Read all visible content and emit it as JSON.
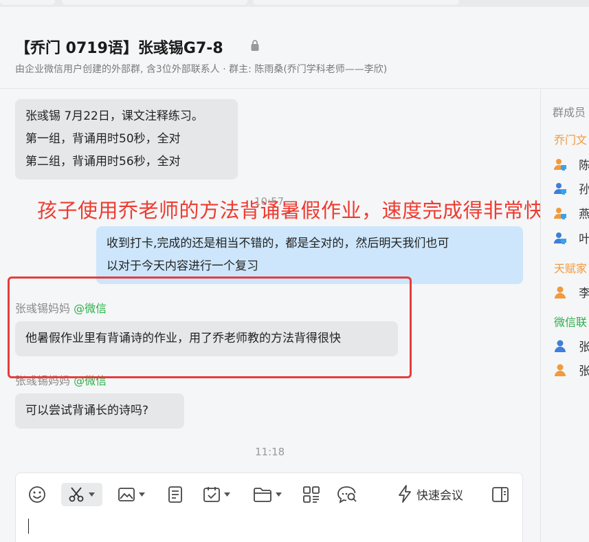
{
  "header": {
    "title": "【乔门 0719语】张彧锡G7-8",
    "subtitle": "由企业微信用户创建的外部群, 含3位外部联系人 · 群主: 陈雨桑(乔门学科老师——李欣)"
  },
  "messages": {
    "msg1": {
      "lines": [
        "张彧锡 7月22日，课文注释练习。",
        "第一组，背诵用时50秒，全对",
        "第二组，背诵用时56秒，全对"
      ]
    },
    "time1": "10:57",
    "msg2": {
      "lines": [
        "收到打卡,完成的还是相当不错的，都是全对的，然后明天我们也可",
        "以对于今天内容进行一个复习"
      ]
    },
    "msg3": {
      "sender": "张彧锡妈妈",
      "sender_suffix": "@微信",
      "text": "他暑假作业里有背诵诗的作业，用了乔老师教的方法背得很快"
    },
    "msg4": {
      "sender": "张彧锡妈妈",
      "sender_suffix": "@微信",
      "text": "可以尝试背诵长的诗吗?"
    },
    "time2": "11:18"
  },
  "overlay": {
    "annotation": "孩子使用乔老师的方法背诵暑假作业，速度完成得非常快"
  },
  "sidebar": {
    "title": "群成员",
    "groups": [
      {
        "label": "乔门文",
        "color": "#f29a3c",
        "members": [
          {
            "name": "陈",
            "icon": "user-enterprise-icon",
            "color": "#f29a3c"
          },
          {
            "name": "孙",
            "icon": "user-enterprise-icon",
            "color": "#3d7fd9"
          },
          {
            "name": "燕",
            "icon": "user-enterprise-icon",
            "color": "#f29a3c"
          },
          {
            "name": "叶",
            "icon": "user-enterprise-icon",
            "color": "#3d7fd9"
          }
        ]
      },
      {
        "label": "天赋家",
        "color": "#f29a3c",
        "members": [
          {
            "name": "李",
            "icon": "user-icon",
            "color": "#f29a3c"
          }
        ]
      },
      {
        "label": "微信联",
        "color": "#2bb04a",
        "members": [
          {
            "name": "张",
            "icon": "user-icon",
            "color": "#3d7fd9"
          },
          {
            "name": "张",
            "icon": "user-icon",
            "color": "#f29a3c"
          }
        ]
      }
    ]
  },
  "composer": {
    "toolbar": [
      "emoji-icon",
      "screenshot-scissors-icon",
      "image-icon",
      "document-icon",
      "schedule-icon",
      "folder-icon",
      "apps-grid-icon",
      "chat-search-icon"
    ],
    "quick_meeting_label": "快速会议",
    "quick_meeting_icon": "lightning-icon",
    "sidebar_toggle_icon": "sidebar-toggle-icon"
  },
  "colors": {
    "accent_green": "#2bb04a",
    "overlay_red": "#ee3b30",
    "bubble_gray": "#e6e7e9",
    "bubble_blue": "#cde6fb"
  }
}
